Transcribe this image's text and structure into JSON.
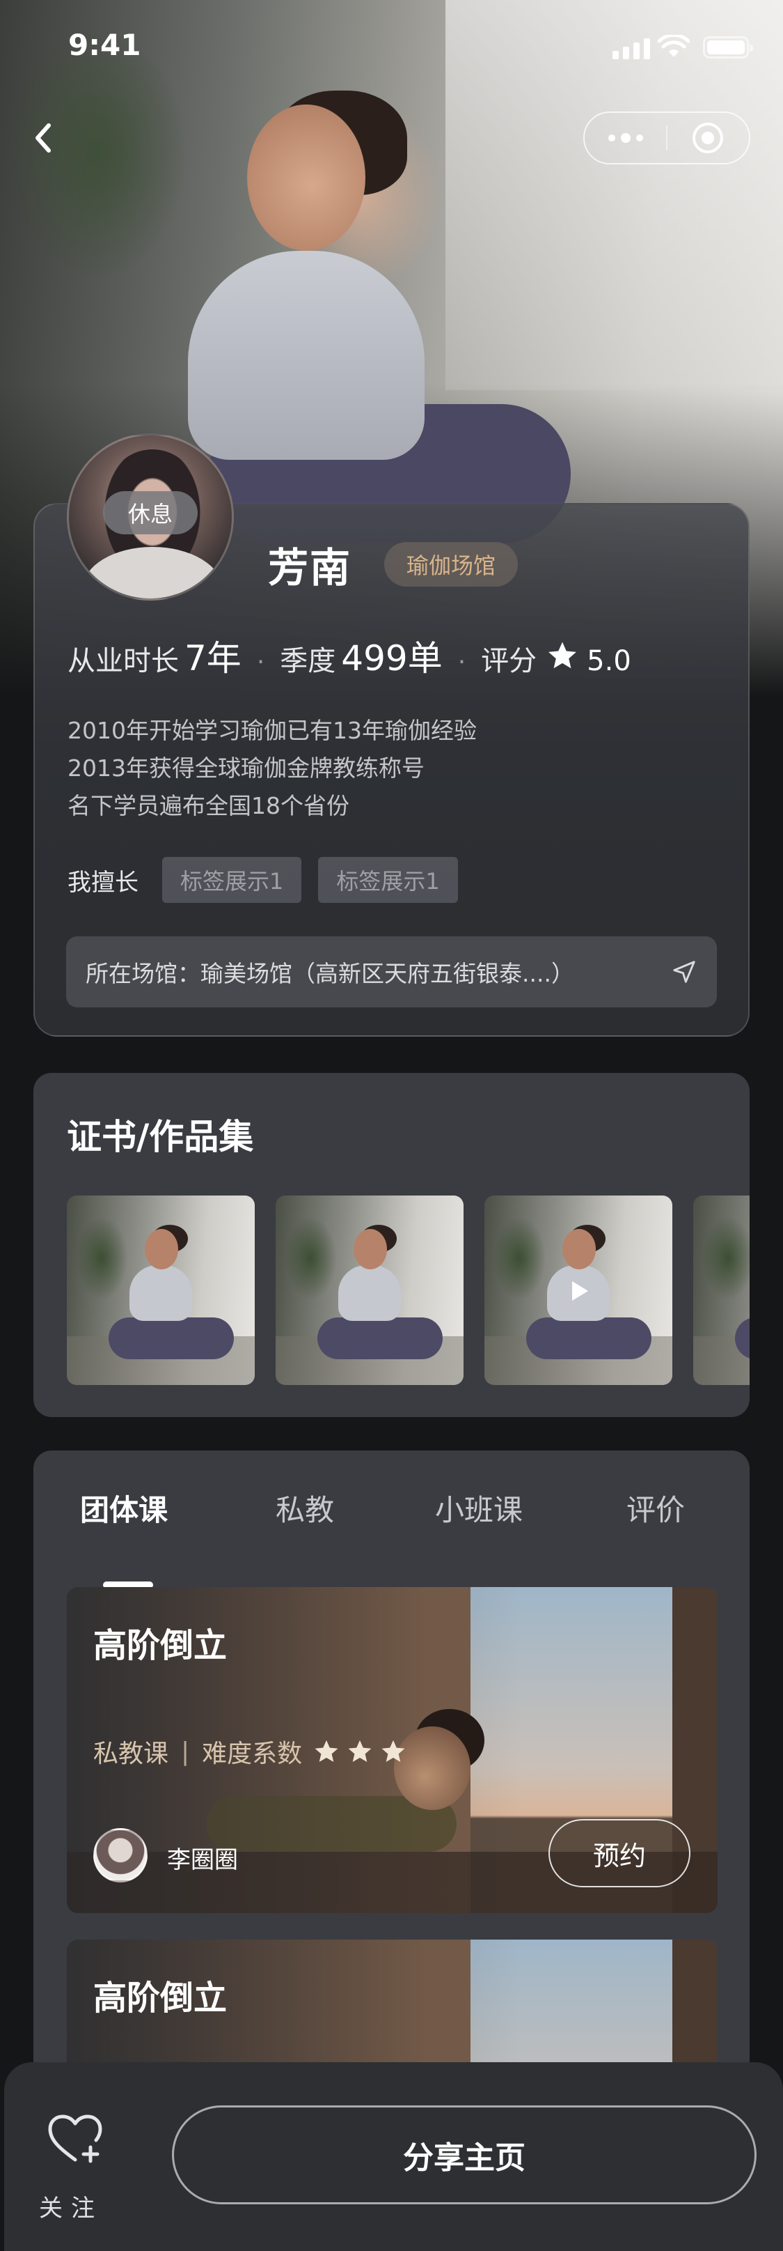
{
  "status_bar": {
    "time": "9:41"
  },
  "profile": {
    "status_badge": "休息",
    "name": "芳南",
    "venue_tag": "瑜伽场馆",
    "stats": {
      "experience_label": "从业时长",
      "experience_value": "7年",
      "season_label": "季度",
      "season_value": "499单",
      "rating_label": "评分",
      "rating_value": "5.0"
    },
    "bio_lines": [
      "2010年开始学习瑜伽已有13年瑜伽经验",
      "2013年获得全球瑜伽金牌教练称号",
      "名下学员遍布全国18个省份"
    ],
    "skills_label": "我擅长",
    "skills": [
      "标签展示1",
      "标签展示1"
    ],
    "address": "所在场馆：瑜美场馆（高新区天府五街银泰....）"
  },
  "certificates": {
    "title": "证书/作品集"
  },
  "courses": {
    "tabs": [
      {
        "label": "团体课",
        "active": true
      },
      {
        "label": "私教",
        "active": false
      },
      {
        "label": "小班课",
        "active": false
      },
      {
        "label": "评价",
        "active": false
      }
    ],
    "items": [
      {
        "title": "高阶倒立",
        "type": "私教课",
        "difficulty_label": "难度系数",
        "difficulty_stars": 3,
        "teacher": "李圈圈",
        "book_label": "预约"
      },
      {
        "title": "高阶倒立"
      }
    ]
  },
  "bottom_bar": {
    "follow_label": "关注",
    "share_label": "分享主页"
  },
  "colors": {
    "accent_gold": "#d9b48a",
    "card_bg": "#3a3c42",
    "page_bg": "#151617"
  }
}
